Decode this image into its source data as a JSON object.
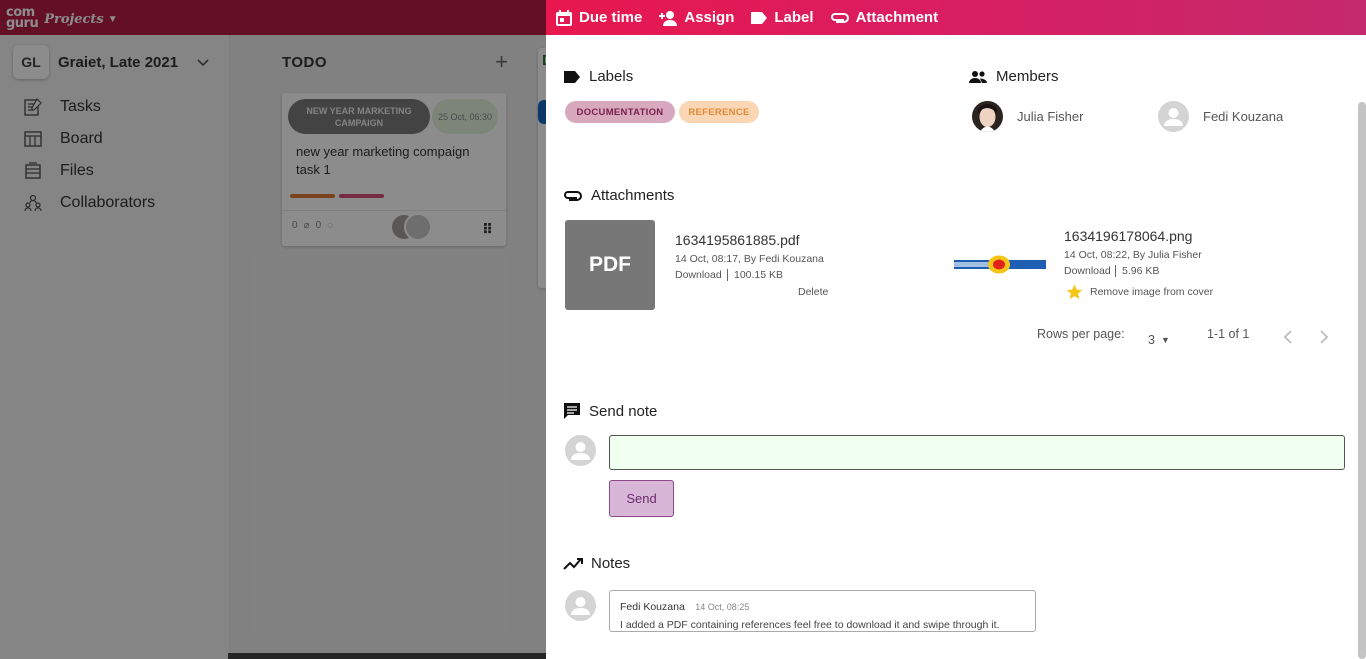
{
  "app": {
    "logo_top": "com",
    "logo_bottom": "guru",
    "logo_sub": "Projects"
  },
  "sidebar": {
    "workspace_badge": "GL",
    "workspace_name": "Graiet, Late 2021",
    "items": [
      {
        "label": "Tasks",
        "icon": "tasks-icon"
      },
      {
        "label": "Board",
        "icon": "board-icon"
      },
      {
        "label": "Files",
        "icon": "files-icon"
      },
      {
        "label": "Collaborators",
        "icon": "collaborators-icon"
      }
    ]
  },
  "board": {
    "column_title": "TODO",
    "next_column_letter": "D",
    "card": {
      "campaign_chip": "NEW YEAR MARKETING CAMPAIGN",
      "date_chip": "25 Oct, 06:30",
      "title": "new year marketing compaign task 1",
      "attachments_count": "0",
      "comments_count": "0",
      "bar_colors": [
        "#e07a35",
        "#d94f7a"
      ]
    }
  },
  "drawer": {
    "actions": {
      "due_time": "Due time",
      "assign": "Assign",
      "label": "Label",
      "attachment": "Attachment"
    },
    "labels": {
      "title": "Labels",
      "chips": [
        {
          "text": "DOCUMENTATION",
          "bg": "#d8a8be",
          "fg": "#7a1f4a"
        },
        {
          "text": "REFERENCE",
          "bg": "#fbd6b4",
          "fg": "#e08a3a"
        }
      ]
    },
    "members": {
      "title": "Members",
      "list": [
        {
          "name": "Julia Fisher"
        },
        {
          "name": "Fedi Kouzana"
        }
      ]
    },
    "attachments": {
      "title": "Attachments",
      "items": [
        {
          "thumb_text": "PDF",
          "name": "1634195861885.pdf",
          "meta": "14 Oct, 08:17, By Fedi Kouzana",
          "download": "Download",
          "size": "100.15 KB",
          "delete": "Delete"
        },
        {
          "name": "1634196178064.png",
          "meta": "14 Oct, 08:22, By Julia Fisher",
          "download": "Download",
          "size": "5.96 KB",
          "cover_action": "Remove image from cover"
        }
      ],
      "pagination": {
        "rows_label": "Rows per page:",
        "rows_value": "3",
        "range": "1-1 of 1"
      }
    },
    "send_note": {
      "title": "Send note",
      "input_value": "",
      "button": "Send"
    },
    "notes": {
      "title": "Notes",
      "items": [
        {
          "author": "Fedi Kouzana",
          "time": "14 Oct, 08:25",
          "text": "I added a PDF containing references feel free to download it and swipe through it."
        }
      ]
    }
  }
}
